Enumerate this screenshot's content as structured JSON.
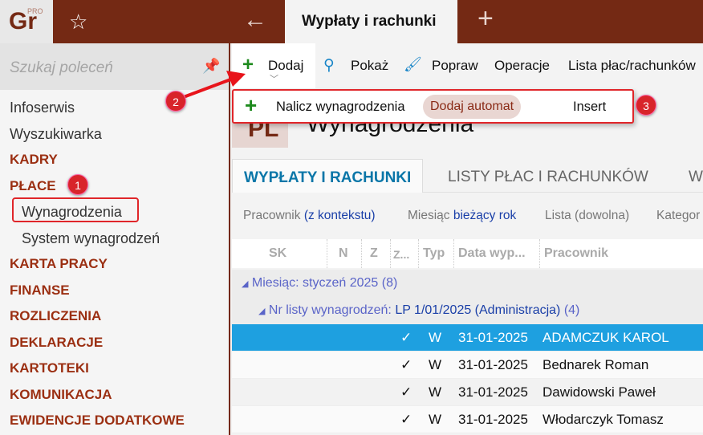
{
  "app": {
    "logo": "Gr",
    "logo_sup": "PRO",
    "active_tab": "Wypłaty i rachunki"
  },
  "sidebar": {
    "search_placeholder": "Szukaj poleceń",
    "items": [
      {
        "label": "Infoserwis",
        "type": "item"
      },
      {
        "label": "Wyszukiwarka",
        "type": "item"
      },
      {
        "label": "KADRY",
        "type": "sec"
      },
      {
        "label": "PŁACE",
        "type": "sec"
      },
      {
        "label": "Wynagrodzenia",
        "type": "sub"
      },
      {
        "label": "System wynagrodzeń",
        "type": "sub"
      },
      {
        "label": "KARTA PRACY",
        "type": "sec"
      },
      {
        "label": "FINANSE",
        "type": "sec"
      },
      {
        "label": "ROZLICZENIA",
        "type": "sec"
      },
      {
        "label": "DEKLARACJE",
        "type": "sec"
      },
      {
        "label": "KARTOTEKI",
        "type": "sec"
      },
      {
        "label": "KOMUNIKACJA",
        "type": "sec"
      },
      {
        "label": "EWIDENCJE DODATKOWE",
        "type": "sec"
      }
    ]
  },
  "toolbar": {
    "add": "Dodaj",
    "show": "Pokaż",
    "edit": "Popraw",
    "operations": "Operacje",
    "lists": "Lista płac/rachunków"
  },
  "popup": {
    "label": "Nalicz wynagrodzenia",
    "tag": "Dodaj automat",
    "shortcut": "Insert"
  },
  "page": {
    "icon": "PL",
    "title": "Wynagrodzenia"
  },
  "tabs": [
    "WYPŁATY I RACHUNKI",
    "LISTY PŁAC I RACHUNKÓW",
    "W"
  ],
  "filters": {
    "f1": "Pracownik",
    "v1": "(z kontekstu)",
    "f2": "Miesiąc",
    "v2": "bieżący rok",
    "f3": "Lista (dowolna)",
    "f4": "Kategor"
  },
  "grid": {
    "columns": [
      "SK",
      "N",
      "Z",
      "Z...",
      "Typ",
      "Data wyp...",
      "Pracownik"
    ],
    "group1": "Miesiąc: styczeń 2025 (8)",
    "group2_label": "Nr listy wynagrodzeń:",
    "group2_value": "LP 1/01/2025 (Administracja)",
    "group2_count": "(4)",
    "rows": [
      {
        "z": "✓",
        "typ": "W",
        "date": "31-01-2025",
        "name": "ADAMCZUK KAROL"
      },
      {
        "z": "✓",
        "typ": "W",
        "date": "31-01-2025",
        "name": "Bednarek Roman"
      },
      {
        "z": "✓",
        "typ": "W",
        "date": "31-01-2025",
        "name": "Dawidowski Paweł"
      },
      {
        "z": "✓",
        "typ": "W",
        "date": "31-01-2025",
        "name": "Włodarczyk Tomasz"
      }
    ]
  },
  "annotations": [
    "1",
    "2",
    "3"
  ],
  "colors": {
    "brand": "#742914",
    "accent": "#0a76a8",
    "selection": "#1ea0e0",
    "annotation": "#d8242a"
  }
}
